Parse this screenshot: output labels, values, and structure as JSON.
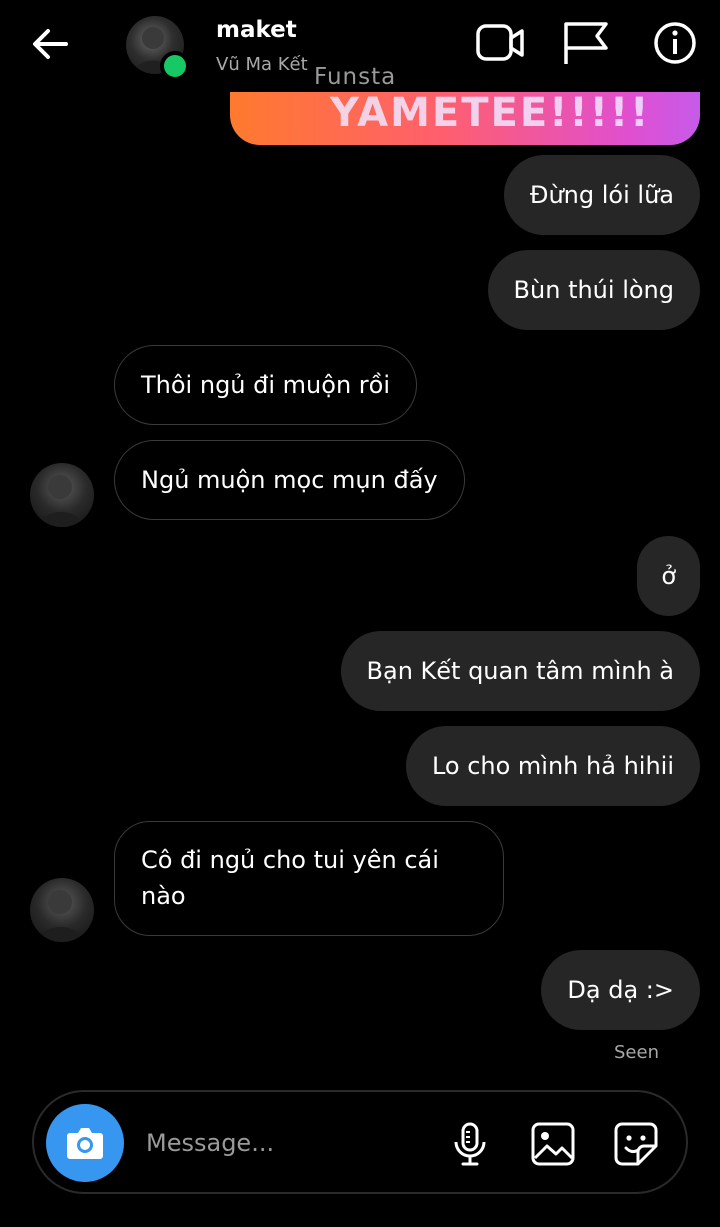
{
  "header": {
    "name": "maket",
    "subtitle": "Vũ Ma Kết",
    "watermark": "Funsta",
    "icons": {
      "back": "arrow-left-icon",
      "video": "video-call-icon",
      "flag": "flag-icon",
      "info": "info-icon"
    }
  },
  "image_message": {
    "text": "YAMETEE!!!!!"
  },
  "messages": [
    {
      "sender": "me",
      "text": "Đừng lói lữa"
    },
    {
      "sender": "me",
      "text": "Bùn thúi lòng"
    },
    {
      "sender": "them",
      "text": "Thôi ngủ đi muộn rồi"
    },
    {
      "sender": "them",
      "text": "Ngủ muộn mọc mụn đấy"
    },
    {
      "sender": "me",
      "text": "ở"
    },
    {
      "sender": "me",
      "text": "Bạn Kết quan tâm mình à"
    },
    {
      "sender": "me",
      "text": "Lo cho mình hả hihii"
    },
    {
      "sender": "them",
      "text": "Cô đi ngủ cho tui yên cái nào"
    },
    {
      "sender": "me",
      "text": "Dạ dạ :>"
    }
  ],
  "seen_label": "Seen",
  "composer": {
    "placeholder": "Message...",
    "icons": {
      "camera": "camera-icon",
      "mic": "microphone-icon",
      "gallery": "gallery-icon",
      "sticker": "sticker-icon"
    }
  },
  "colors": {
    "accent": "#3797f0",
    "online": "#17c964",
    "bubble_out": "#262626",
    "background": "#000000"
  }
}
